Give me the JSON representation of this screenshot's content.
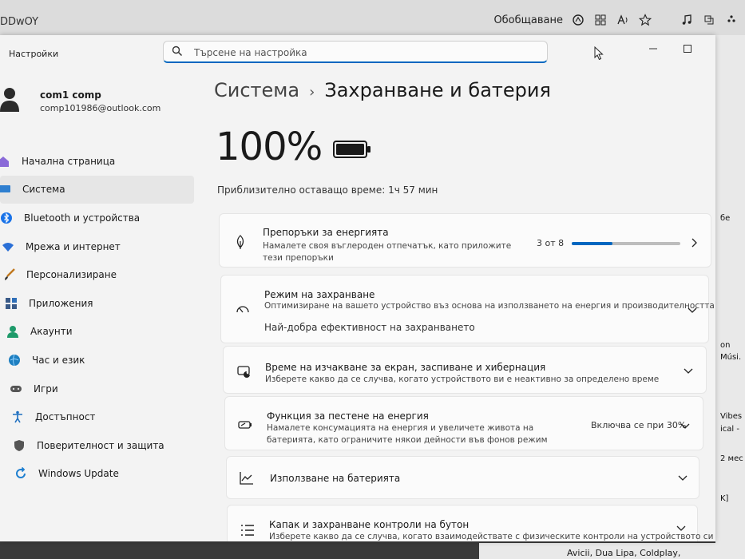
{
  "browser": {
    "tab_text": "DDwOY",
    "summary_label": "Обобщаване"
  },
  "background_page": {
    "strip_texts": [
      "бе",
      "on",
      "Músi.",
      "Vibes",
      "ical -",
      "2 мес",
      "K]"
    ],
    "bottom_text": "Avicii, Dua Lipa, Coldplay,"
  },
  "window": {
    "title": "Настройки",
    "search_placeholder": "Търсене на настройка"
  },
  "user": {
    "name": "com1 comp",
    "email": "comp101986@outlook.com"
  },
  "nav": {
    "items": [
      {
        "label": "Начална страница",
        "icon": "home-icon"
      },
      {
        "label": "Система",
        "icon": "system-icon",
        "active": true
      },
      {
        "label": "Bluetooth и устройства",
        "icon": "bluetooth-icon"
      },
      {
        "label": "Мрежа и интернет",
        "icon": "wifi-icon"
      },
      {
        "label": "Персонализиране",
        "icon": "brush-icon"
      },
      {
        "label": "Приложения",
        "icon": "apps-icon"
      },
      {
        "label": "Акаунти",
        "icon": "account-icon"
      },
      {
        "label": "Час и език",
        "icon": "globe-icon"
      },
      {
        "label": "Игри",
        "icon": "gamepad-icon"
      },
      {
        "label": "Достъпност",
        "icon": "accessibility-icon"
      },
      {
        "label": "Поверителност и защита",
        "icon": "shield-icon"
      },
      {
        "label": "Windows Update",
        "icon": "update-icon"
      }
    ]
  },
  "content": {
    "breadcrumb_parent": "Система",
    "breadcrumb_current": "Захранване и батерия",
    "battery_percent": "100%",
    "battery_level": 1.0,
    "remaining_time": "Приблизително оставащо време: 1ч 57 мин",
    "cards": {
      "energy": {
        "title": "Препоръки за енергията",
        "desc": "Намалете своя въглероден отпечатък, като приложите тези препоръки",
        "progress_text": "3 от 8",
        "progress_fraction": 0.375
      },
      "power_mode": {
        "title": "Режим на захранване",
        "desc": "Оптимизиране на вашето устройство въз основа на използването на енергия и производителността",
        "value": "Най-добра ефективност на захранването"
      },
      "screen_sleep": {
        "title": "Време на изчакване за екран, заспиване и хибернация",
        "desc": "Изберете какво да се случва, когато устройството ви е неактивно за определено време"
      },
      "saver": {
        "title": "Функция за пестене на енергия",
        "desc": "Намалете консумацията на енергия и увеличете живота на батерията, като ограничите някои дейности във фонов режим",
        "value": "Включва се при 30%"
      },
      "usage": {
        "title": "Използване на батерията"
      },
      "lid": {
        "title": "Капак и захранване контроли на бутон",
        "desc": "Изберете какво да се случва, когато взаимодействате с физическите контроли на устройството си"
      }
    }
  },
  "colors": {
    "accent": "#0067c0",
    "window_bg": "#f3f3f3",
    "card_bg": "#fbfbfb"
  }
}
